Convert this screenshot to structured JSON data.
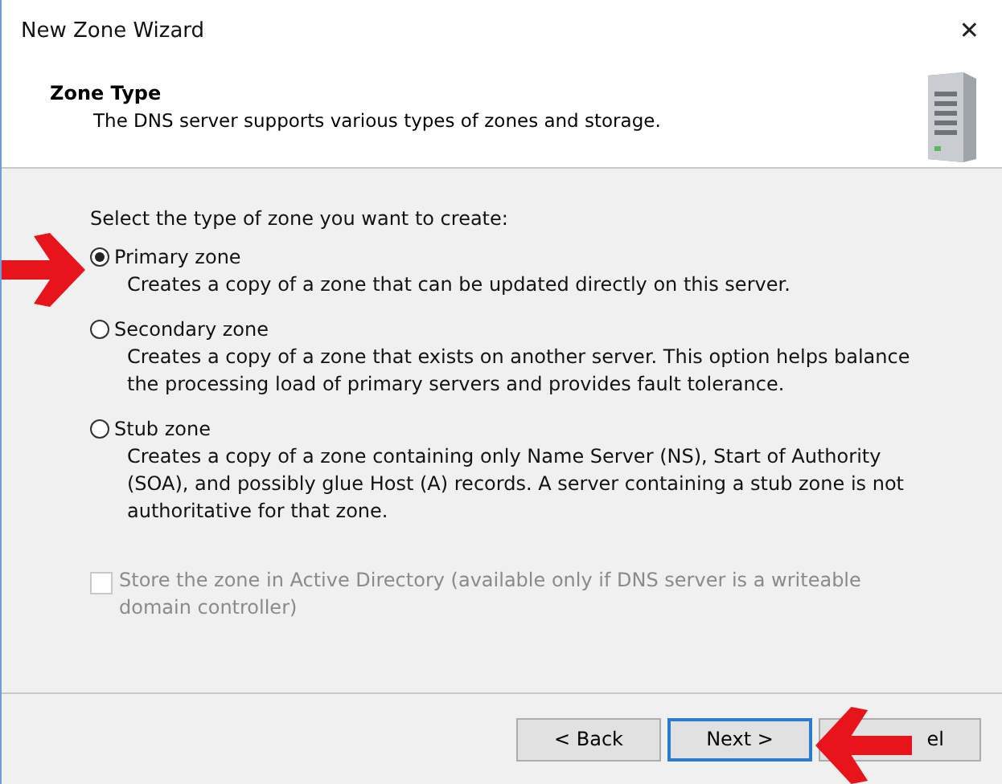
{
  "window": {
    "title": "New Zone Wizard",
    "close": "✕"
  },
  "header": {
    "title": "Zone Type",
    "subtitle": "The DNS server supports various types of zones and storage."
  },
  "prompt": "Select the type of zone you want to create:",
  "options": [
    {
      "label": "Primary zone",
      "description": "Creates a copy of a zone that can be updated directly on this server.",
      "selected": true
    },
    {
      "label": "Secondary zone",
      "description": "Creates a copy of a zone that exists on another server. This option helps balance the processing load of primary servers and provides fault tolerance.",
      "selected": false
    },
    {
      "label": "Stub zone",
      "description": "Creates a copy of a zone containing only Name Server (NS), Start of Authority (SOA), and possibly glue Host (A) records. A server containing a stub zone is not authoritative for that zone.",
      "selected": false
    }
  ],
  "store_in_ad": {
    "label": "Store the zone in Active Directory (available only if DNS server is a writeable domain controller)",
    "checked": false,
    "disabled": true
  },
  "buttons": [
    {
      "label": "< Back",
      "focused": false
    },
    {
      "label": "Next >",
      "focused": true
    },
    {
      "label": "el",
      "focused": false
    }
  ]
}
